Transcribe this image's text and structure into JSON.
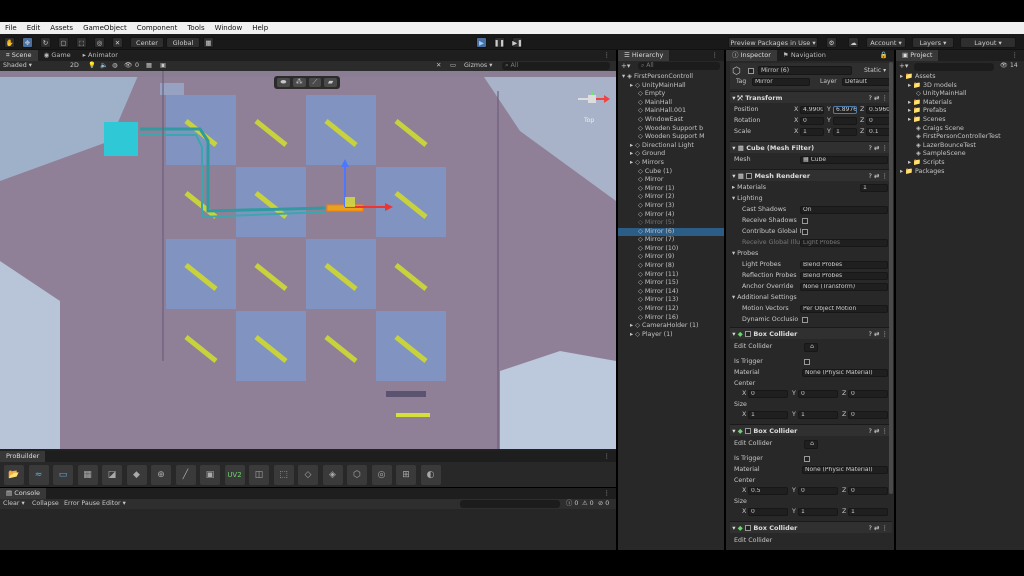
{
  "menu": [
    "File",
    "Edit",
    "Assets",
    "GameObject",
    "Component",
    "Tools",
    "Window",
    "Help"
  ],
  "toolbar": {
    "pivot": "Center",
    "space": "Global",
    "preview_packages": "Preview Packages in Use",
    "account": "Account",
    "layers": "Layers",
    "layout": "Layout"
  },
  "scene": {
    "tabs": [
      "Scene",
      "Game",
      "Animator"
    ],
    "shading_mode": "Shaded",
    "mode_2d": "2D",
    "fx_count": "0",
    "gizmos": "Gizmos",
    "search_placeholder": "All",
    "gizmo_label": "Top",
    "colors": {
      "background": "#8f8098",
      "tile": "#7f98c8",
      "mirror": "#c8d23c",
      "cube": "#2ec8d6",
      "laser": "#2f9aa0"
    }
  },
  "probuilder": {
    "title": "ProBuilder",
    "uv_tool": "UV2"
  },
  "console": {
    "title": "Console",
    "clear": "Clear",
    "collapse": "Collapse",
    "error_pause": "Error Pause",
    "editor": "Editor",
    "counts": [
      "0",
      "0",
      "0"
    ]
  },
  "hierarchy": {
    "title": "Hierarchy",
    "search_placeholder": "All",
    "items": [
      {
        "label": "FirstPersonControll",
        "depth": 0,
        "state": "normal"
      },
      {
        "label": "UnityMainHall",
        "depth": 1,
        "state": "normal"
      },
      {
        "label": "Empty",
        "depth": 2,
        "state": "normal"
      },
      {
        "label": "MainHall",
        "depth": 2,
        "state": "normal"
      },
      {
        "label": "MainHall.001",
        "depth": 2,
        "state": "normal"
      },
      {
        "label": "WindowEast",
        "depth": 2,
        "state": "normal"
      },
      {
        "label": "Wooden Support b",
        "depth": 2,
        "state": "normal"
      },
      {
        "label": "Wooden Support M",
        "depth": 2,
        "state": "normal"
      },
      {
        "label": "Directional Light",
        "depth": 1,
        "state": "normal"
      },
      {
        "label": "Ground",
        "depth": 1,
        "state": "normal"
      },
      {
        "label": "Mirrors",
        "depth": 1,
        "state": "normal"
      },
      {
        "label": "Cube (1)",
        "depth": 2,
        "state": "normal"
      },
      {
        "label": "Mirror",
        "depth": 2,
        "state": "normal"
      },
      {
        "label": "Mirror (1)",
        "depth": 2,
        "state": "normal"
      },
      {
        "label": "Mirror (2)",
        "depth": 2,
        "state": "normal"
      },
      {
        "label": "Mirror (3)",
        "depth": 2,
        "state": "normal"
      },
      {
        "label": "Mirror (4)",
        "depth": 2,
        "state": "normal"
      },
      {
        "label": "Mirror (5)",
        "depth": 2,
        "state": "dim"
      },
      {
        "label": "Mirror (6)",
        "depth": 2,
        "state": "selected"
      },
      {
        "label": "Mirror (7)",
        "depth": 2,
        "state": "normal"
      },
      {
        "label": "Mirror (10)",
        "depth": 2,
        "state": "normal"
      },
      {
        "label": "Mirror (9)",
        "depth": 2,
        "state": "normal"
      },
      {
        "label": "Mirror (8)",
        "depth": 2,
        "state": "normal"
      },
      {
        "label": "Mirror (11)",
        "depth": 2,
        "state": "normal"
      },
      {
        "label": "Mirror (15)",
        "depth": 2,
        "state": "normal"
      },
      {
        "label": "Mirror (14)",
        "depth": 2,
        "state": "normal"
      },
      {
        "label": "Mirror (13)",
        "depth": 2,
        "state": "normal"
      },
      {
        "label": "Mirror (12)",
        "depth": 2,
        "state": "normal"
      },
      {
        "label": "Mirror (16)",
        "depth": 2,
        "state": "normal"
      },
      {
        "label": "CameraHolder (1)",
        "depth": 1,
        "state": "normal"
      },
      {
        "label": "Player (1)",
        "depth": 1,
        "state": "normal"
      }
    ]
  },
  "inspector": {
    "tabs": [
      "Inspector",
      "Navigation"
    ],
    "object_name": "Mirror (6)",
    "static_label": "Static",
    "tag_label": "Tag",
    "tag_value": "Mirror",
    "layer_label": "Layer",
    "layer_value": "Default",
    "transform": {
      "title": "Transform",
      "position_label": "Position",
      "rotation_label": "Rotation",
      "scale_label": "Scale",
      "position": {
        "x": "4.9900",
        "y": "6.8976",
        "z": "0.5960"
      },
      "rotation": {
        "x": "0",
        "y": "",
        "z": "0"
      },
      "scale": {
        "x": "1",
        "y": "1",
        "z": "0.1"
      }
    },
    "mesh_filter": {
      "title": "Cube (Mesh Filter)",
      "mesh_label": "Mesh",
      "mesh_value": "Cube"
    },
    "mesh_renderer": {
      "title": "Mesh Renderer",
      "materials_label": "Materials",
      "materials_count": "1",
      "lighting": "Lighting",
      "cast_shadows_label": "Cast Shadows",
      "cast_shadows_value": "On",
      "receive_shadows_label": "Receive Shadows",
      "contribute_gi_label": "Contribute Global I",
      "receive_gi_label": "Receive Global Illu",
      "receive_gi_value": "Light Probes",
      "probes": "Probes",
      "light_probes_label": "Light Probes",
      "light_probes_value": "Blend Probes",
      "reflection_probes_label": "Reflection Probes",
      "reflection_probes_value": "Blend Probes",
      "anchor_override_label": "Anchor Override",
      "anchor_override_value": "None (Transform)",
      "additional": "Additional Settings",
      "motion_vectors_label": "Motion Vectors",
      "motion_vectors_value": "Per Object Motion",
      "dynamic_occlusion_label": "Dynamic Occlusio"
    },
    "box_colliders": [
      {
        "title": "Box Collider",
        "edit_collider": "Edit Collider",
        "is_trigger": "Is Trigger",
        "material_label": "Material",
        "material_value": "None (Physic Material)",
        "center_label": "Center",
        "center": {
          "x": "0",
          "y": "0",
          "z": "0"
        },
        "size_label": "Size",
        "size": {
          "x": "1",
          "y": "1",
          "z": "0"
        }
      },
      {
        "title": "Box Collider",
        "edit_collider": "Edit Collider",
        "is_trigger": "Is Trigger",
        "material_label": "Material",
        "material_value": "None (Physic Material)",
        "center_label": "Center",
        "center": {
          "x": "0.5",
          "y": "0",
          "z": "0"
        },
        "size_label": "Size",
        "size": {
          "x": "0",
          "y": "1",
          "z": "1"
        }
      },
      {
        "title": "Box Collider",
        "edit_collider": "Edit Collider"
      }
    ]
  },
  "project": {
    "title": "Project",
    "count_badge": "14",
    "tree": [
      {
        "label": "Assets",
        "depth": 0,
        "type": "folder"
      },
      {
        "label": "3D models",
        "depth": 1,
        "type": "folder"
      },
      {
        "label": "UnityMainHall",
        "depth": 2,
        "type": "asset"
      },
      {
        "label": "Materials",
        "depth": 1,
        "type": "folder"
      },
      {
        "label": "Prefabs",
        "depth": 1,
        "type": "folder"
      },
      {
        "label": "Scenes",
        "depth": 1,
        "type": "folder"
      },
      {
        "label": "Craigs Scene",
        "depth": 2,
        "type": "scene"
      },
      {
        "label": "FirstPersonControllerTest",
        "depth": 2,
        "type": "scene"
      },
      {
        "label": "LazerBounceTest",
        "depth": 2,
        "type": "scene"
      },
      {
        "label": "SampleScene",
        "depth": 2,
        "type": "scene"
      },
      {
        "label": "Scripts",
        "depth": 1,
        "type": "folder"
      },
      {
        "label": "Packages",
        "depth": 0,
        "type": "folder"
      }
    ]
  }
}
